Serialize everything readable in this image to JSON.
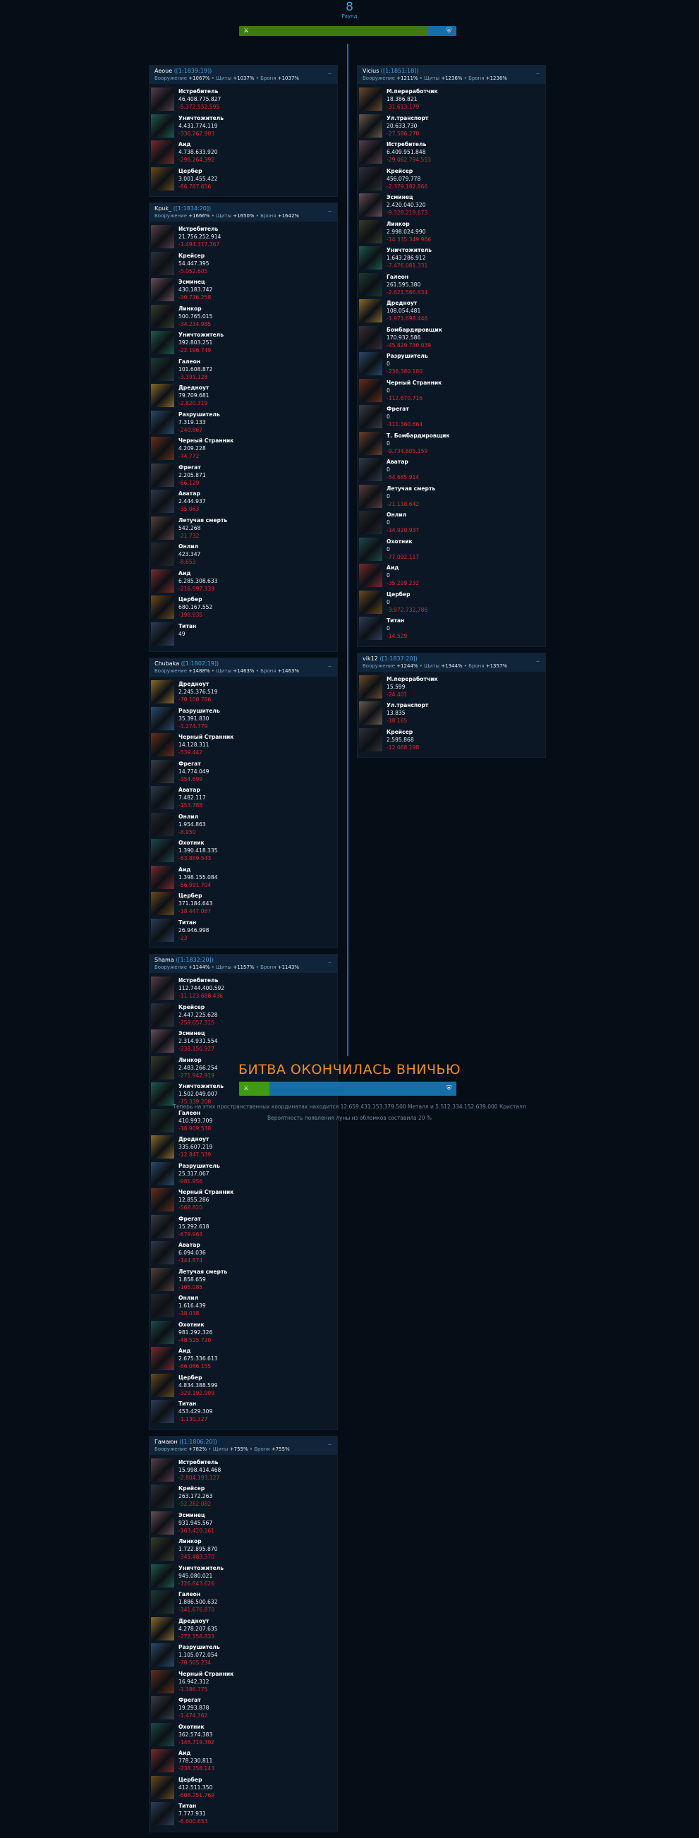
{
  "round": {
    "number": "8",
    "label": "Раунд"
  },
  "colors": {
    "accent": "#3aa6e0",
    "attack_bar": "#3d7a12",
    "defense_bar": "#166ea8",
    "loss": "#e8242e",
    "result": "#f08c1c",
    "bg": "#050d17"
  },
  "top_bar": {
    "attacker_share": 0.87
  },
  "bottom_bar": {
    "attacker_share": 0.14
  },
  "stat_labels": {
    "weapons": "Вооружение",
    "shields": "Щиты",
    "armor": "Броня"
  },
  "attackers": [
    {
      "name": "Aeoue",
      "coords": "([1:1839:19])",
      "weapons": "+1067%",
      "shields": "+1037%",
      "armor": "+1037%",
      "ships": [
        {
          "name": "Истребитель",
          "count": "46.408.775.827",
          "loss": "-5.372.552.595",
          "icon": "fighter-icon",
          "tone": "#5a3e48"
        },
        {
          "name": "Уничтожитель",
          "count": "4.431.774.119",
          "loss": "-336.267.903",
          "icon": "destroyer-icon",
          "tone": "#1e5a4a"
        },
        {
          "name": "Аид",
          "count": "4.738.633.920",
          "loss": "-296.264.392",
          "icon": "hades-icon",
          "tone": "#7a2a2c"
        },
        {
          "name": "Цербер",
          "count": "3.001.455.422",
          "loss": "-86.787.656",
          "icon": "cerberus-icon",
          "tone": "#6a4a1c"
        }
      ]
    },
    {
      "name": "Kpuk_",
      "coords": "([1:1834:20])",
      "weapons": "+1666%",
      "shields": "+1650%",
      "armor": "+1642%",
      "ships": [
        {
          "name": "Истребитель",
          "count": "21.756.252.914",
          "loss": "-1.494.317.367",
          "icon": "fighter-icon",
          "tone": "#5a3e48"
        },
        {
          "name": "Крейсер",
          "count": "54.447.395",
          "loss": "-5.052.605",
          "icon": "cruiser-icon",
          "tone": "#2e3238"
        },
        {
          "name": "Эсминец",
          "count": "430.183.742",
          "loss": "-30.736.258",
          "icon": "escort-icon",
          "tone": "#6a4e58"
        },
        {
          "name": "Линкор",
          "count": "500.765.015",
          "loss": "-34.234.985",
          "icon": "battleship-icon",
          "tone": "#3a3a2a"
        },
        {
          "name": "Уничтожитель",
          "count": "392.803.251",
          "loss": "-22.196.749",
          "icon": "destroyer-icon",
          "tone": "#1e5a4a"
        },
        {
          "name": "Галеон",
          "count": "101.608.872",
          "loss": "-3.391.128",
          "icon": "galleon-icon",
          "tone": "#1e3a34"
        },
        {
          "name": "Дредноут",
          "count": "79.709.681",
          "loss": "-2.820.319",
          "icon": "dreadnought-icon",
          "tone": "#8a6a2a"
        },
        {
          "name": "Разрушитель",
          "count": "7.319.133",
          "loss": "-240.867",
          "icon": "razor-icon",
          "tone": "#2a4a6a"
        },
        {
          "name": "Черный Странник",
          "count": "4.209.228",
          "loss": "-74.772",
          "icon": "black-wanderer-icon",
          "tone": "#6a2e1a"
        },
        {
          "name": "Фрегат",
          "count": "2.205.871",
          "loss": "-66.129",
          "icon": "frigate-icon",
          "tone": "#3a3e44"
        },
        {
          "name": "Аватар",
          "count": "2.444.937",
          "loss": "-35.063",
          "icon": "avatar-icon",
          "tone": "#2e3a48"
        },
        {
          "name": "Летучая смерть",
          "count": "542.268",
          "loss": "-21.732",
          "icon": "flying-death-icon",
          "tone": "#5a3e3a"
        },
        {
          "name": "Онлил",
          "count": "423.347",
          "loss": "-8.653",
          "icon": "onlil-icon",
          "tone": "#26282c"
        },
        {
          "name": "Аид",
          "count": "6.285.308.633",
          "loss": "-216.997.339",
          "icon": "hades-icon",
          "tone": "#7a2a2c"
        },
        {
          "name": "Цербер",
          "count": "680.167.552",
          "loss": "-198.935",
          "icon": "cerberus-icon",
          "tone": "#6a4a1c"
        },
        {
          "name": "Титан",
          "count": "49",
          "loss": "",
          "icon": "titan-icon",
          "tone": "#2e3e5a"
        }
      ]
    },
    {
      "name": "Chubaka",
      "coords": "([1:1802:19])",
      "weapons": "+1488%",
      "shields": "+1463%",
      "armor": "+1463%",
      "ships": [
        {
          "name": "Дредноут",
          "count": "2.245.376.519",
          "loss": "-70.100.786",
          "icon": "dreadnought-icon",
          "tone": "#8a6a2a"
        },
        {
          "name": "Разрушитель",
          "count": "35.391.830",
          "loss": "-1.274.779",
          "icon": "razor-icon",
          "tone": "#2a4a6a"
        },
        {
          "name": "Черный Странник",
          "count": "14.128.311",
          "loss": "-539.442",
          "icon": "black-wanderer-icon",
          "tone": "#6a2e1a"
        },
        {
          "name": "Фрегат",
          "count": "14.774.049",
          "loss": "-354.699",
          "icon": "frigate-icon",
          "tone": "#3a3e44"
        },
        {
          "name": "Аватар",
          "count": "7.482.117",
          "loss": "-153.788",
          "icon": "avatar-icon",
          "tone": "#2e3a48"
        },
        {
          "name": "Онлил",
          "count": "1.954.863",
          "loss": "-8.950",
          "icon": "onlil-icon",
          "tone": "#26282c"
        },
        {
          "name": "Охотник",
          "count": "1.390.418.335",
          "loss": "-63.889.543",
          "icon": "hunter-icon",
          "tone": "#1e4a4a"
        },
        {
          "name": "Аид",
          "count": "1.398.155.084",
          "loss": "-56.991.704",
          "icon": "hades-icon",
          "tone": "#7a2a2c"
        },
        {
          "name": "Цербер",
          "count": "371.184.643",
          "loss": "-18.447.087",
          "icon": "cerberus-icon",
          "tone": "#6a4a1c"
        },
        {
          "name": "Титан",
          "count": "26.946.998",
          "loss": "-23",
          "icon": "titan-icon",
          "tone": "#2e3e5a"
        }
      ]
    },
    {
      "name": "Shama",
      "coords": "([1:1832:20])",
      "weapons": "+1144%",
      "shields": "+1157%",
      "armor": "+1143%",
      "ships": [
        {
          "name": "Истребитель",
          "count": "112.744.400.592",
          "loss": "-11.123.688.436",
          "icon": "fighter-icon",
          "tone": "#5a3e48"
        },
        {
          "name": "Крейсер",
          "count": "2.447.225.628",
          "loss": "-259.657.315",
          "icon": "cruiser-icon",
          "tone": "#2e3238"
        },
        {
          "name": "Эсминец",
          "count": "2.314.931.554",
          "loss": "-238.150.927",
          "icon": "escort-icon",
          "tone": "#6a4e58"
        },
        {
          "name": "Линкор",
          "count": "2.483.266.254",
          "loss": "-271.947.919",
          "icon": "battleship-icon",
          "tone": "#3a3a2a"
        },
        {
          "name": "Уничтожитель",
          "count": "1.502.049.007",
          "loss": "-75.339.208",
          "icon": "destroyer-icon",
          "tone": "#1e5a4a"
        },
        {
          "name": "Галеон",
          "count": "410.993.709",
          "loss": "-18.909.538",
          "icon": "galleon-icon",
          "tone": "#1e3a34"
        },
        {
          "name": "Дредноут",
          "count": "335.607.219",
          "loss": "-12.847.539",
          "icon": "dreadnought-icon",
          "tone": "#8a6a2a"
        },
        {
          "name": "Разрушитель",
          "count": "25.317.067",
          "loss": "-981.956",
          "icon": "razor-icon",
          "tone": "#2a4a6a"
        },
        {
          "name": "Черный Странник",
          "count": "12.855.286",
          "loss": "-568.820",
          "icon": "black-wanderer-icon",
          "tone": "#6a2e1a"
        },
        {
          "name": "Фрегат",
          "count": "15.292.618",
          "loss": "-679.963",
          "icon": "frigate-icon",
          "tone": "#3a3e44"
        },
        {
          "name": "Аватар",
          "count": "6.094.036",
          "loss": "-144.874",
          "icon": "avatar-icon",
          "tone": "#2e3a48"
        },
        {
          "name": "Летучая смерть",
          "count": "1.858.659",
          "loss": "-105.085",
          "icon": "flying-death-icon",
          "tone": "#5a3e3a"
        },
        {
          "name": "Онлил",
          "count": "1.616.439",
          "loss": "-18.038",
          "icon": "onlil-icon",
          "tone": "#26282c"
        },
        {
          "name": "Охотник",
          "count": "981.292.326",
          "loss": "-48.525.720",
          "icon": "hunter-icon",
          "tone": "#1e4a4a"
        },
        {
          "name": "Аид",
          "count": "2.675.336.613",
          "loss": "-66.086.155",
          "icon": "hades-icon",
          "tone": "#7a2a2c"
        },
        {
          "name": "Цербер",
          "count": "4.834.388.599",
          "loss": "-329.192.909",
          "icon": "cerberus-icon",
          "tone": "#6a4a1c"
        },
        {
          "name": "Титан",
          "count": "453.429.309",
          "loss": "-1.130.327",
          "icon": "titan-icon",
          "tone": "#2e3e5a"
        }
      ]
    },
    {
      "name": "Гамаюн",
      "coords": "([1:1806:20])",
      "weapons": "+782%",
      "shields": "+755%",
      "armor": "+755%",
      "ships": [
        {
          "name": "Истребитель",
          "count": "15.998.414.468",
          "loss": "-2.804.193.127",
          "icon": "fighter-icon",
          "tone": "#5a3e48"
        },
        {
          "name": "Крейсер",
          "count": "263.172.263",
          "loss": "-52.282.082",
          "icon": "cruiser-icon",
          "tone": "#2e3238"
        },
        {
          "name": "Эсминец",
          "count": "931.945.567",
          "loss": "-163.420.161",
          "icon": "escort-icon",
          "tone": "#6a4e58"
        },
        {
          "name": "Линкор",
          "count": "1.722.895.870",
          "loss": "-345.483.570",
          "icon": "battleship-icon",
          "tone": "#3a3a2a"
        },
        {
          "name": "Уничтожитель",
          "count": "945.080.021",
          "loss": "-126.843.626",
          "icon": "destroyer-icon",
          "tone": "#1e5a4a"
        },
        {
          "name": "Галеон",
          "count": "1.886.500.632",
          "loss": "-141.676.870",
          "icon": "galleon-icon",
          "tone": "#1e3a34"
        },
        {
          "name": "Дредноут",
          "count": "4.278.207.635",
          "loss": "-272.158.833",
          "icon": "dreadnought-icon",
          "tone": "#8a6a2a"
        },
        {
          "name": "Разрушитель",
          "count": "1.105.072.054",
          "loss": "-70.505.234",
          "icon": "razor-icon",
          "tone": "#2a4a6a"
        },
        {
          "name": "Черный Странник",
          "count": "16.942.312",
          "loss": "-1.386.775",
          "icon": "black-wanderer-icon",
          "tone": "#6a2e1a"
        },
        {
          "name": "Фрегат",
          "count": "19.293.878",
          "loss": "-1.474.362",
          "icon": "frigate-icon",
          "tone": "#3a3e44"
        },
        {
          "name": "Охотник",
          "count": "362.574.383",
          "loss": "-146.719.302",
          "icon": "hunter-icon",
          "tone": "#1e4a4a"
        },
        {
          "name": "Аид",
          "count": "778.230.811",
          "loss": "-238.358.143",
          "icon": "hades-icon",
          "tone": "#7a2a2c"
        },
        {
          "name": "Цербер",
          "count": "412.511.350",
          "loss": "-608.251.769",
          "icon": "cerberus-icon",
          "tone": "#6a4a1c"
        },
        {
          "name": "Титан",
          "count": "7.777.931",
          "loss": "-6.600.653",
          "icon": "titan-icon",
          "tone": "#2e3e5a"
        }
      ]
    }
  ],
  "defenders": [
    {
      "name": "Vicius",
      "coords": "([1:1851:18])",
      "weapons": "+1211%",
      "shields": "+1236%",
      "armor": "+1236%",
      "ships": [
        {
          "name": "М.переработчик",
          "count": "18.386.821",
          "loss": "-31.613.179",
          "icon": "recycler-icon",
          "tone": "#6a4a2a"
        },
        {
          "name": "Ул.транспорт",
          "count": "20.633.730",
          "loss": "-27.586.270",
          "icon": "transport-icon",
          "tone": "#6a5a4a"
        },
        {
          "name": "Истребитель",
          "count": "6.409.951.848",
          "loss": "-29.062.794.553",
          "icon": "fighter-icon",
          "tone": "#5a3e48"
        },
        {
          "name": "Крейсер",
          "count": "456.079.778",
          "loss": "-2.379.182.866",
          "icon": "cruiser-icon",
          "tone": "#2e3238"
        },
        {
          "name": "Эсминец",
          "count": "2.420.040.320",
          "loss": "-9.328.219.673",
          "icon": "escort-icon",
          "tone": "#6a4e58"
        },
        {
          "name": "Линкор",
          "count": "2.998.024.990",
          "loss": "-14.335.349.966",
          "icon": "battleship-icon",
          "tone": "#3a3a2a"
        },
        {
          "name": "Уничтожитель",
          "count": "1.643.286.912",
          "loss": "-7.476.081.331",
          "icon": "destroyer-icon",
          "tone": "#1e5a4a"
        },
        {
          "name": "Галеон",
          "count": "261.595.380",
          "loss": "-2.621.566.634",
          "icon": "galleon-icon",
          "tone": "#1e3a34"
        },
        {
          "name": "Дредноут",
          "count": "108.054.481",
          "loss": "-1.971.698.446",
          "icon": "dreadnought-icon",
          "tone": "#8a6a2a"
        },
        {
          "name": "Бомбардировщик",
          "count": "170.932.586",
          "loss": "-45.829.730.039",
          "icon": "bomber-icon",
          "tone": "#3a2e34"
        },
        {
          "name": "Разрушитель",
          "count": "0",
          "loss": "-236.380.180",
          "icon": "razor-icon",
          "tone": "#2a4a6a"
        },
        {
          "name": "Черный Странник",
          "count": "0",
          "loss": "-112.670.716",
          "icon": "black-wanderer-icon",
          "tone": "#6a2e1a"
        },
        {
          "name": "Фрегат",
          "count": "0",
          "loss": "-111.360.664",
          "icon": "frigate-icon",
          "tone": "#3a3e44"
        },
        {
          "name": "Т. Бомбардировщик",
          "count": "0",
          "loss": "-9.734.605.159",
          "icon": "heavy-bomber-icon",
          "tone": "#6a3e2a"
        },
        {
          "name": "Аватар",
          "count": "0",
          "loss": "-54.685.914",
          "icon": "avatar-icon",
          "tone": "#2e3a48"
        },
        {
          "name": "Летучая смерть",
          "count": "0",
          "loss": "-21.118.642",
          "icon": "flying-death-icon",
          "tone": "#5a3e3a"
        },
        {
          "name": "Онлил",
          "count": "0",
          "loss": "-14.920.937",
          "icon": "onlil-icon",
          "tone": "#26282c"
        },
        {
          "name": "Охотник",
          "count": "0",
          "loss": "-77.092.117",
          "icon": "hunter-icon",
          "tone": "#1e4a4a"
        },
        {
          "name": "Аид",
          "count": "0",
          "loss": "-35.299.232",
          "icon": "hades-icon",
          "tone": "#7a2a2c"
        },
        {
          "name": "Цербер",
          "count": "0",
          "loss": "-3.972.732.786",
          "icon": "cerberus-icon",
          "tone": "#6a4a1c"
        },
        {
          "name": "Титан",
          "count": "0",
          "loss": "-14.529",
          "icon": "titan-icon",
          "tone": "#2e3e5a"
        }
      ]
    },
    {
      "name": "vik12",
      "coords": "([1:1837:20])",
      "weapons": "+1244%",
      "shields": "+1344%",
      "armor": "+1357%",
      "ships": [
        {
          "name": "М.переработчик",
          "count": "15.599",
          "loss": "-24.401",
          "icon": "recycler-icon",
          "tone": "#6a4a2a"
        },
        {
          "name": "Ул.транспорт",
          "count": "13.835",
          "loss": "-18.165",
          "icon": "transport-icon",
          "tone": "#6a5a4a"
        },
        {
          "name": "Крейсер",
          "count": "2.595.868",
          "loss": "-12.068.198",
          "icon": "cruiser-icon",
          "tone": "#2e3238"
        }
      ]
    }
  ],
  "result": "БИТВА ОКОНЧИЛАСЬ ВНИЧЬЮ",
  "footer": {
    "debris": "Теперь на этих пространственных координатах находится 12.659.431.153.379.500 Металл и 5.512.334.152.639.000 Кристалл",
    "moon": "Вероятность появления луны из обломков составила 20 %"
  }
}
